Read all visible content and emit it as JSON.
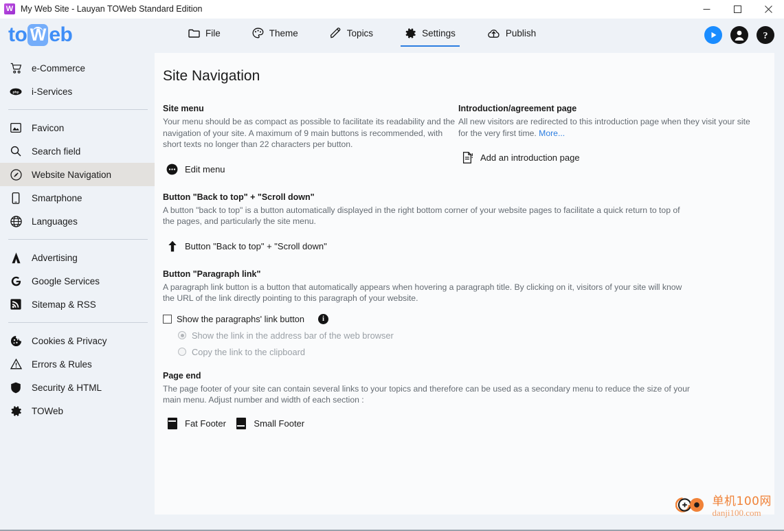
{
  "window": {
    "title": "My Web Site - Lauyan TOWeb Standard Edition",
    "app_icon": "toweb-app-icon",
    "minimize_label": "Minimize",
    "maximize_label": "Maximize",
    "close_label": "Close"
  },
  "brand": {
    "part1": "to",
    "part2": "W",
    "part3": "eb"
  },
  "toolbar": {
    "tabs": [
      {
        "label": "File",
        "icon": "folder-icon",
        "active": false
      },
      {
        "label": "Theme",
        "icon": "palette-icon",
        "active": false
      },
      {
        "label": "Topics",
        "icon": "pencil-icon",
        "active": false
      },
      {
        "label": "Settings",
        "icon": "gear-icon",
        "active": true
      },
      {
        "label": "Publish",
        "icon": "cloud-upload-icon",
        "active": false
      }
    ],
    "preview_label": "Preview",
    "account_label": "Account",
    "help_label": "Help",
    "accent_color": "#2b7de0",
    "play_color": "#1a8cff"
  },
  "sidebar": {
    "groups": [
      {
        "items": [
          {
            "label": "e-Commerce",
            "icon": "shopping-cart-icon",
            "selected": false
          },
          {
            "label": "i-Services",
            "icon": "php-icon",
            "selected": false
          }
        ]
      },
      {
        "items": [
          {
            "label": "Favicon",
            "icon": "image-icon",
            "selected": false
          },
          {
            "label": "Search field",
            "icon": "search-icon",
            "selected": false
          },
          {
            "label": "Website Navigation",
            "icon": "compass-icon",
            "selected": true
          },
          {
            "label": "Smartphone",
            "icon": "smartphone-icon",
            "selected": false
          },
          {
            "label": "Languages",
            "icon": "globe-icon",
            "selected": false
          }
        ]
      },
      {
        "items": [
          {
            "label": "Advertising",
            "icon": "adsense-icon",
            "selected": false
          },
          {
            "label": "Google Services",
            "icon": "google-icon",
            "selected": false
          },
          {
            "label": "Sitemap & RSS",
            "icon": "rss-icon",
            "selected": false
          }
        ]
      },
      {
        "items": [
          {
            "label": "Cookies & Privacy",
            "icon": "cookie-icon",
            "selected": false
          },
          {
            "label": "Errors & Rules",
            "icon": "warning-triangle-icon",
            "selected": false
          },
          {
            "label": "Security & HTML",
            "icon": "shield-icon",
            "selected": false
          },
          {
            "label": "TOWeb",
            "icon": "gear-icon",
            "selected": false
          }
        ]
      }
    ]
  },
  "main": {
    "title": "Site Navigation",
    "site_menu": {
      "heading": "Site menu",
      "description": "Your menu should be as compact as possible to facilitate its readability and the navigation of your site. A maximum of 9 main buttons is recommended, with short texts no longer than 22 characters per button.",
      "action_label": "Edit menu",
      "action_icon": "three-dots-circle-icon"
    },
    "introduction": {
      "heading": "Introduction/agreement page",
      "description": "All new visitors are redirected to this introduction page when they visit your site for the very first time. ",
      "more_label": "More...",
      "action_label": "Add an introduction page",
      "action_icon": "new-document-icon"
    },
    "back_to_top": {
      "heading": "Button \"Back to top\" + \"Scroll down\"",
      "description": "A button \"back to top\" is a button automatically displayed in the right bottom corner of your website pages to facilitate a quick return to top of the pages, and particularly the site menu.",
      "action_label": "Button \"Back to top\" + \"Scroll down\"",
      "action_icon": "arrow-up-icon"
    },
    "paragraph_link": {
      "heading": "Button \"Paragraph link\"",
      "description": "A paragraph link button is a button that automatically appears when hovering a paragraph title. By clicking on it, visitors of your site will know the URL of the link directly pointing to this paragraph of your website.",
      "checkbox_label": "Show the paragraphs' link button",
      "checkbox_checked": false,
      "info_glyph": "i",
      "options": [
        {
          "label": "Show the link in the address bar of the web browser",
          "selected": true
        },
        {
          "label": "Copy the link to the clipboard",
          "selected": false
        }
      ]
    },
    "page_end": {
      "heading": "Page end",
      "description": "The page footer of your site can contain several links to your topics and therefore can be used as a secondary menu to reduce the size of your main menu. Adjust number and width of each section :",
      "options": [
        {
          "label": "Fat Footer",
          "icon": "fat-footer-icon"
        },
        {
          "label": "Small Footer",
          "icon": "small-footer-icon"
        }
      ]
    }
  },
  "watermark": {
    "cn": "单机100网",
    "en": "danji100.com",
    "color": "#f08238"
  }
}
